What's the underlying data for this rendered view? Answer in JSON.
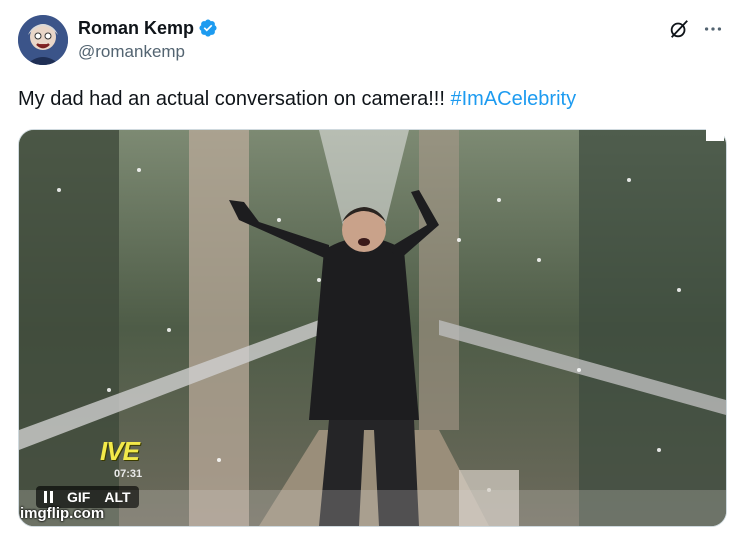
{
  "user": {
    "name": "Roman Kemp",
    "handle": "@romankemp",
    "verified": true
  },
  "icons": {
    "verified": "verified-badge-icon",
    "grok": "grok-icon",
    "more": "more-options-icon",
    "pause": "pause-icon"
  },
  "tweet": {
    "text": "My dad had an actual conversation on camera!!! ",
    "hashtag": "#ImACelebrity"
  },
  "media": {
    "type": "gif",
    "controls": {
      "gif_label": "GIF",
      "alt_label": "ALT"
    },
    "overlay": {
      "live": "IVE",
      "time": "07:31",
      "watermark": "imgflip.com"
    }
  },
  "colors": {
    "accent": "#1d9bf0",
    "text": "#0f1419",
    "secondary": "#536471"
  }
}
